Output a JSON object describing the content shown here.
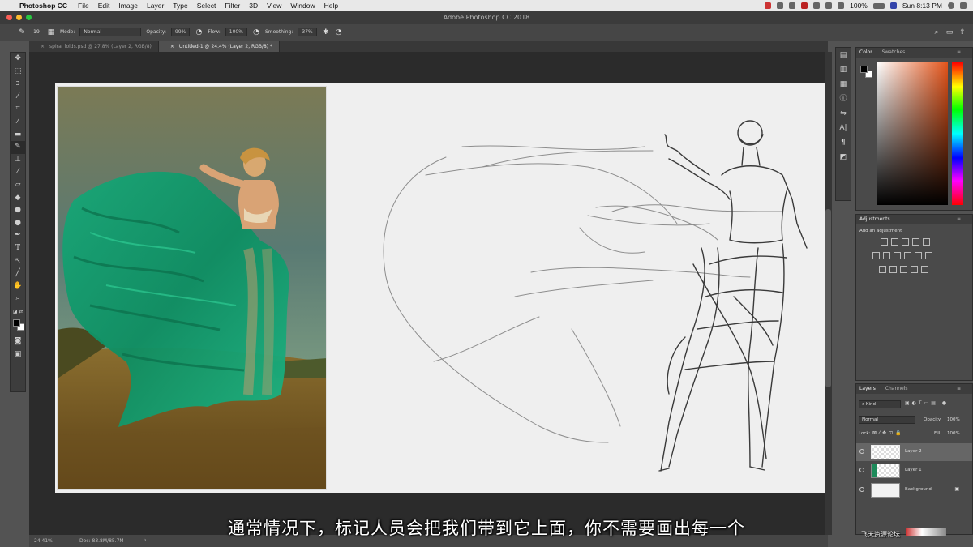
{
  "menubar": {
    "app_name": "Photoshop CC",
    "items": [
      "File",
      "Edit",
      "Image",
      "Layer",
      "Type",
      "Select",
      "Filter",
      "3D",
      "View",
      "Window",
      "Help"
    ],
    "battery": "100%",
    "clock": "Sun 8:13 PM"
  },
  "window": {
    "title": "Adobe Photoshop CC 2018"
  },
  "options_bar": {
    "brush_size": "19",
    "mode_label": "Mode:",
    "mode_value": "Normal",
    "opacity_label": "Opacity:",
    "opacity_value": "99%",
    "flow_label": "Flow:",
    "flow_value": "100%",
    "smoothing_label": "Smoothing:",
    "smoothing_value": "37%"
  },
  "tabs": [
    {
      "label": "spiral folds.psd @ 27.8% (Layer 2, RGB/8)"
    },
    {
      "label": "Untitled-1 @ 24.4% (Layer 2, RGB/8) *"
    }
  ],
  "status": {
    "zoom": "24.41%",
    "doc": "Doc: 83.8M/85.7M"
  },
  "panels": {
    "color_tab": "Color",
    "swatches_tab": "Swatches",
    "adjustments_title": "Adjustments",
    "add_adjustment": "Add an adjustment",
    "layers_tab": "Layers",
    "channels_tab": "Channels",
    "kind_label": "Kind",
    "blend_mode": "Normal",
    "opacity_label": "Opacity:",
    "opacity_value": "100%",
    "lock_label": "Lock:",
    "fill_label": "Fill:",
    "fill_value": "100%"
  },
  "layers": [
    {
      "name": "Layer 2"
    },
    {
      "name": "Layer 1"
    },
    {
      "name": "Background"
    }
  ],
  "subtitle": "通常情况下，标记人员会把我们带到它上面，你不需要画出每一个",
  "watermark": "飞天资源论坛"
}
